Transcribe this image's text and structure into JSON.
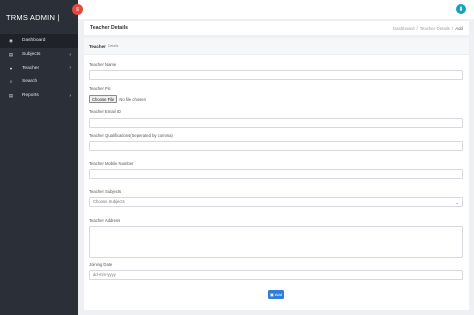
{
  "sidebar": {
    "brand": "TRMS ADMIN |",
    "items": [
      {
        "label": "Dashboard",
        "icon": "dashboard-icon",
        "glyph": "◉",
        "active": true,
        "has_submenu": false
      },
      {
        "label": "Subjects",
        "icon": "list-icon",
        "glyph": "▤",
        "active": false,
        "has_submenu": true
      },
      {
        "label": "Teacher",
        "icon": "user-icon",
        "glyph": "●",
        "active": false,
        "has_submenu": true
      },
      {
        "label": "Search",
        "icon": "search-icon",
        "glyph": "⌕",
        "active": false,
        "has_submenu": false
      },
      {
        "label": "Reports",
        "icon": "report-icon",
        "glyph": "▤",
        "active": false,
        "has_submenu": true
      }
    ]
  },
  "topbar": {
    "menu_icon": "hamburger-icon",
    "download_icon": "download-icon"
  },
  "pagebar": {
    "title": "Teacher Details",
    "breadcrumbs": [
      "Dashboard",
      "Teacher Details",
      "Add"
    ]
  },
  "form": {
    "card_title": "Teacher",
    "card_subtitle": "Details",
    "name_label": "Teacher Name",
    "pic_label": "Teacher Pic",
    "file_button": "Choose File",
    "file_status": "No file chosen",
    "email_label": "Teacher Email ID",
    "qual_label": "Teacher Qualifications(Seperated by comma)",
    "mobile_label": "Teacher Mobile Number",
    "subjects_label": "Teacher Subjects",
    "subjects_selected": "Choose Subjects",
    "address_label": "Teacher Address",
    "date_label": "Joining Date",
    "date_placeholder": "dd-mm-yyyy",
    "submit_label": "Add"
  },
  "colors": {
    "sidebar": "#2b3038",
    "accent_red": "#e2483d",
    "accent_blue": "#2f7fd8",
    "accent_teal": "#17a2b8"
  }
}
